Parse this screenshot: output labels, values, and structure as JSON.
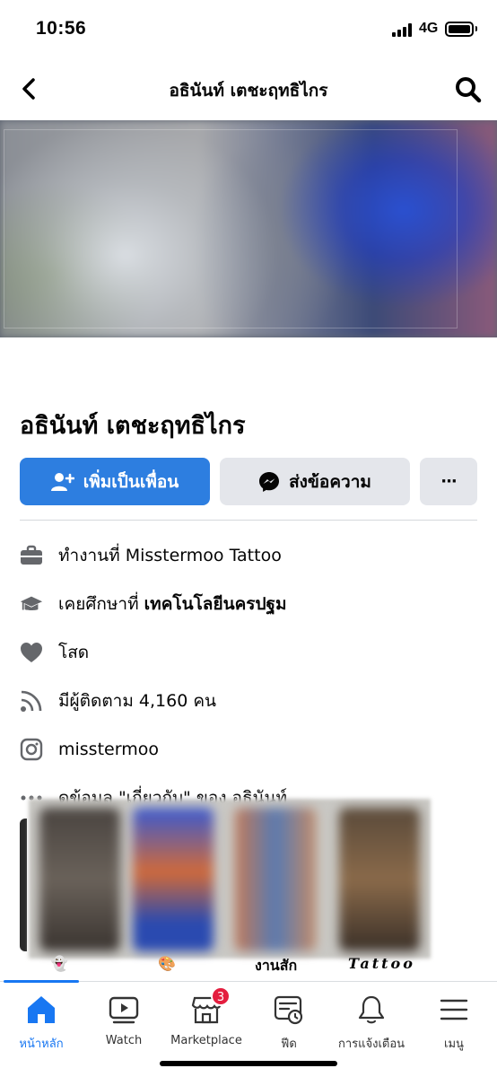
{
  "status": {
    "time": "10:56",
    "network": "4G"
  },
  "header": {
    "title": "อธินันท์ เตชะฤทธิไกร"
  },
  "profile": {
    "name": "อธินันท์ เตชะฤทธิไกร",
    "add_friend": "เพิ่มเป็นเพื่อน",
    "message": "ส่งข้อความ",
    "more": "···"
  },
  "info": [
    {
      "icon": "briefcase-icon",
      "text": "ทำงานที่ Misstermoo Tattoo"
    },
    {
      "icon": "graduation-cap-icon",
      "prefix": "เคยศึกษาที่ ",
      "bold": "เทคโนโลยีนครปฐม"
    },
    {
      "icon": "heart-icon",
      "text": "โสด"
    },
    {
      "icon": "followers-icon",
      "text": "มีผู้ติดตาม 4,160 คน"
    },
    {
      "icon": "instagram-icon",
      "text": "misstermoo"
    },
    {
      "icon": "more-dots-icon",
      "text": "ดูข้อมูล \"เกี่ยวกับ\" ของ อธินันท์"
    }
  ],
  "photo_labels": {
    "ghost": "👻",
    "palette": "🎨",
    "label3": "งานสัก",
    "label4": "Tattoo"
  },
  "tabs": [
    {
      "label": "หน้าหลัก",
      "icon": "home-icon",
      "active": true
    },
    {
      "label": "Watch",
      "icon": "watch-icon"
    },
    {
      "label": "Marketplace",
      "icon": "marketplace-icon",
      "badge": "3"
    },
    {
      "label": "ฟีด",
      "icon": "feed-icon"
    },
    {
      "label": "การแจ้งเตือน",
      "icon": "bell-icon"
    },
    {
      "label": "เมนู",
      "icon": "menu-icon"
    }
  ],
  "colors": {
    "primary": "#2d7ee0",
    "secondary_button": "#e4e6eb",
    "active_tab": "#1877f2",
    "badge": "#e41e3f"
  }
}
